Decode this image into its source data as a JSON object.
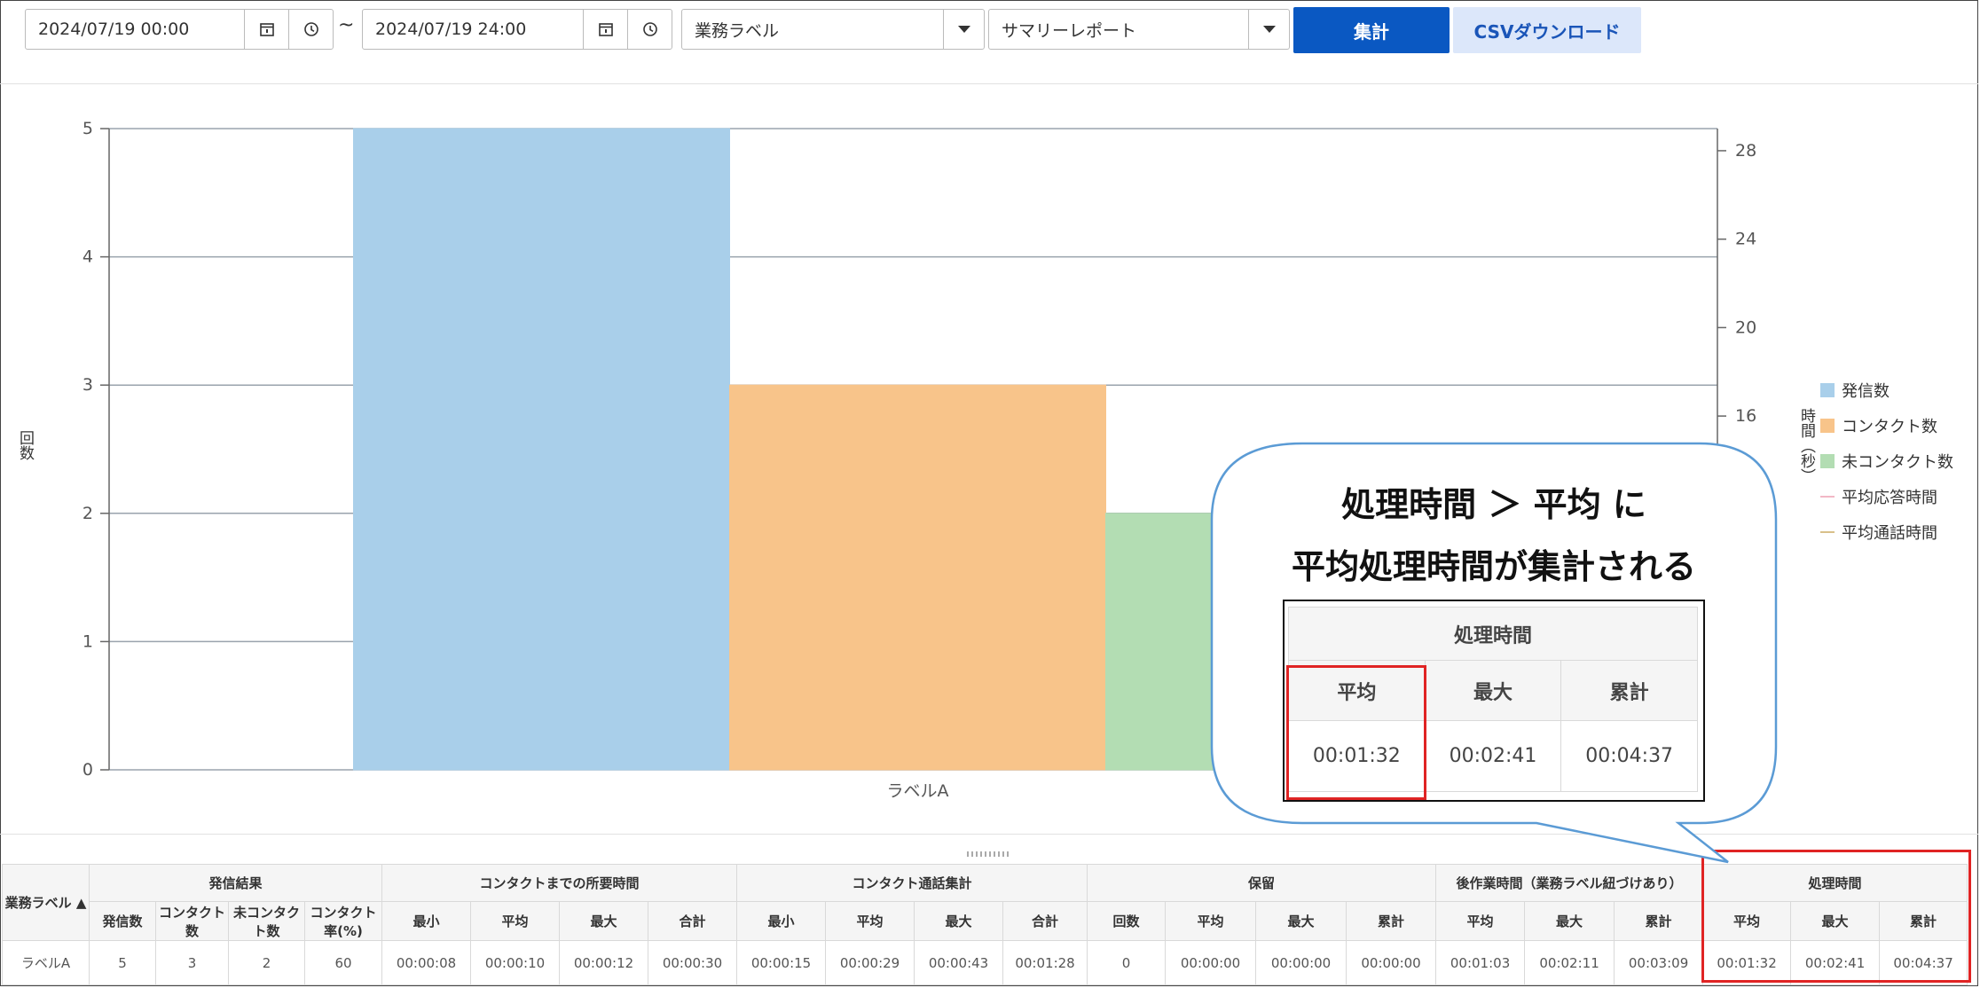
{
  "toolbar": {
    "start_datetime": "2024/07/19 00:00",
    "range_separator": "~",
    "end_datetime": "2024/07/19 24:00",
    "group_select": "業務ラベル",
    "report_select": "サマリーレポート",
    "aggregate_button": "集計",
    "csv_button": "CSVダウンロード"
  },
  "chart_data": {
    "type": "bar",
    "categories": [
      "ラベルA"
    ],
    "series": [
      {
        "name": "発信数",
        "values": [
          5
        ],
        "color": "#a9cfea"
      },
      {
        "name": "コンタクト数",
        "values": [
          3
        ],
        "color": "#f8c48a"
      },
      {
        "name": "未コンタクト数",
        "values": [
          2
        ],
        "color": "#b3ddb3"
      },
      {
        "name": "平均応答時間",
        "values": [],
        "color": "#f2b8c6",
        "kind": "line"
      },
      {
        "name": "平均通話時間",
        "values": [],
        "color": "#d9c08a",
        "kind": "line"
      }
    ],
    "ylabel_left": "回数",
    "ylabel_right": "時間（秒）",
    "yticks_left": [
      "0",
      "1",
      "2",
      "3",
      "4",
      "5"
    ],
    "yticks_right": [
      "16",
      "20",
      "24",
      "28"
    ],
    "ylim_left": [
      0,
      5
    ],
    "ylim_right": [
      0,
      29
    ],
    "grid": true,
    "legend_position": "right"
  },
  "table": {
    "label_header": "業務ラベル ▲",
    "groups": [
      {
        "title": "発信結果",
        "cols": [
          "発信数",
          "コンタクト数",
          "未コンタクト数",
          "コンタクト率(%)"
        ]
      },
      {
        "title": "コンタクトまでの所要時間",
        "cols": [
          "最小",
          "平均",
          "最大",
          "合計"
        ]
      },
      {
        "title": "コンタクト通話集計",
        "cols": [
          "最小",
          "平均",
          "最大",
          "合計"
        ]
      },
      {
        "title": "保留",
        "cols": [
          "回数",
          "平均",
          "最大",
          "累計"
        ]
      },
      {
        "title": "後作業時間（業務ラベル紐づけあり）",
        "cols": [
          "平均",
          "最大",
          "累計"
        ]
      },
      {
        "title": "処理時間",
        "cols": [
          "平均",
          "最大",
          "累計"
        ]
      }
    ],
    "rows": [
      [
        "ラベルA",
        "5",
        "3",
        "2",
        "60",
        "00:00:08",
        "00:00:10",
        "00:00:12",
        "00:00:30",
        "00:00:15",
        "00:00:29",
        "00:00:43",
        "00:01:28",
        "0",
        "00:00:00",
        "00:00:00",
        "00:00:00",
        "00:01:03",
        "00:02:11",
        "00:03:09",
        "00:01:32",
        "00:02:41",
        "00:04:37"
      ]
    ]
  },
  "callout": {
    "line1": "処理時間 ＞ 平均 に",
    "line2": "平均処理時間が集計される",
    "mini_title": "処理時間",
    "mini_cols": [
      "平均",
      "最大",
      "累計"
    ],
    "mini_values": [
      "00:01:32",
      "00:02:41",
      "00:04:37"
    ]
  },
  "icons": {
    "calendar": "calendar-icon",
    "clock": "clock-icon",
    "dropdown": "chevron-down-icon"
  }
}
